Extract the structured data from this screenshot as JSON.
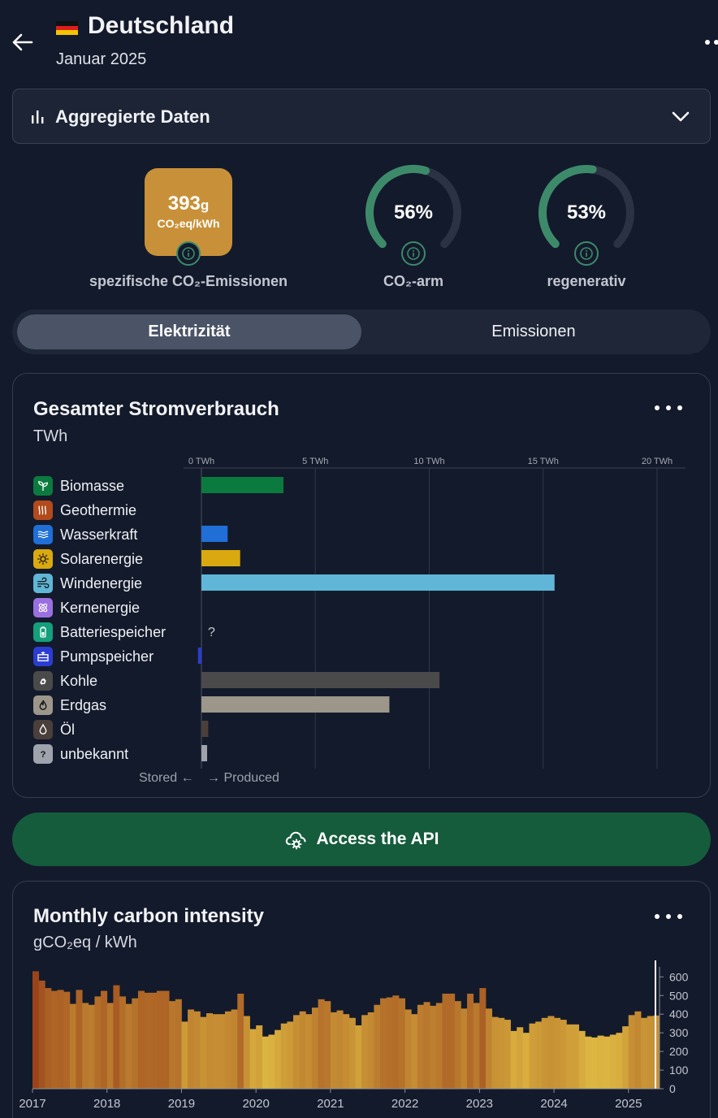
{
  "header": {
    "title": "Deutschland",
    "subtitle": "Januar 2025"
  },
  "dropdown": {
    "label": "Aggregierte Daten"
  },
  "metrics": {
    "co2_value": "393",
    "co2_unit_small": "g",
    "co2_unit": "CO₂eq/kWh",
    "co2_label": "spezifische CO₂-Emissionen",
    "low_carbon_value": "56%",
    "low_carbon_fraction": 0.56,
    "low_carbon_label": "CO₂-arm",
    "renewable_value": "53%",
    "renewable_fraction": 0.53,
    "renewable_label": "regenerativ"
  },
  "tabs": {
    "active": "Elektrizität",
    "inactive": "Emissionen"
  },
  "consumption_card": {
    "title": "Gesamter Stromverbrauch",
    "unit": "TWh",
    "stored_label": "Stored",
    "produced_label": "Produced",
    "unknown_marker": "?"
  },
  "api_button": {
    "label": "Access the API"
  },
  "intensity_card": {
    "title": "Monthly carbon intensity",
    "unit": "gCO₂eq / kWh"
  },
  "colors": {
    "gauge": "#3d8a6a",
    "co2_box": "#c89139",
    "api_button": "#155c3c"
  },
  "chart_data": [
    {
      "type": "bar",
      "orientation": "horizontal",
      "x_ticks": [
        "0 TWh",
        "5 TWh",
        "10 TWh",
        "15 TWh",
        "20 TWh"
      ],
      "xlim": [
        -0.2,
        21
      ],
      "categories": [
        "Biomasse",
        "Geothermie",
        "Wasserkraft",
        "Solarenergie",
        "Windenergie",
        "Kernenergie",
        "Batteriespeicher",
        "Pumpspeicher",
        "Kohle",
        "Erdgas",
        "Öl",
        "unbekannt"
      ],
      "icons": [
        "sprout-icon",
        "geothermal-icon",
        "water-waves-icon",
        "sun-icon",
        "wind-icon",
        "atom-icon",
        "battery-icon",
        "pumped-storage-icon",
        "coal-icon",
        "gas-flame-icon",
        "oil-drop-icon",
        "question-icon"
      ],
      "colors": [
        "#0b7a3e",
        "#b24a1b",
        "#1f6fd6",
        "#d9a90f",
        "#5fb6d6",
        "#9a70e0",
        "#14a07a",
        "#2b3dd1",
        "#4a4a4a",
        "#9c978a",
        "#4a3f3a",
        "#9ea3ad"
      ],
      "values": [
        3.6,
        0,
        1.15,
        1.7,
        15.5,
        0,
        null,
        -0.15,
        10.45,
        8.25,
        0.3,
        0.25
      ],
      "legend": "left"
    },
    {
      "type": "bar",
      "x_ticks": [
        "2017",
        "2018",
        "2019",
        "2020",
        "2021",
        "2022",
        "2023",
        "2024",
        "2025"
      ],
      "y_ticks": [
        0,
        100,
        200,
        300,
        400,
        500,
        600
      ],
      "ylim": [
        0,
        680
      ],
      "start_year": 2017,
      "values": [
        630,
        580,
        540,
        525,
        530,
        520,
        455,
        530,
        460,
        450,
        495,
        525,
        460,
        555,
        495,
        455,
        485,
        525,
        515,
        515,
        525,
        525,
        470,
        480,
        360,
        425,
        415,
        385,
        405,
        400,
        400,
        415,
        425,
        510,
        390,
        320,
        340,
        280,
        290,
        315,
        350,
        360,
        395,
        415,
        400,
        435,
        480,
        470,
        410,
        420,
        400,
        380,
        340,
        395,
        410,
        450,
        485,
        490,
        500,
        485,
        425,
        400,
        450,
        465,
        445,
        460,
        510,
        510,
        470,
        430,
        510,
        460,
        540,
        430,
        385,
        380,
        370,
        310,
        330,
        300,
        350,
        360,
        380,
        390,
        380,
        370,
        345,
        345,
        310,
        280,
        275,
        285,
        280,
        290,
        300,
        335,
        395,
        415,
        380,
        390,
        393
      ]
    }
  ]
}
